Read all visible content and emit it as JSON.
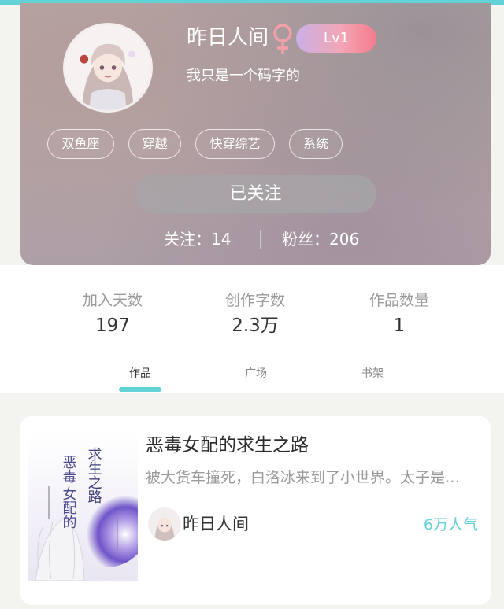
{
  "profile": {
    "username": "昨日人间",
    "gender": "female",
    "level": "Lv1",
    "bio": "我只是一个码字的",
    "tags": [
      "双鱼座",
      "穿越",
      "快穿综艺",
      "系统"
    ],
    "follow_button": "已关注",
    "following": "关注：14",
    "followers": "粉丝：206",
    "colors": {
      "accent": "#62d2d6",
      "female_icon": "#f2a0a8"
    }
  },
  "stats": [
    {
      "label": "加入天数",
      "value": "197"
    },
    {
      "label": "创作字数",
      "value": "2.3万"
    },
    {
      "label": "作品数量",
      "value": "1"
    }
  ],
  "tabs": [
    {
      "label": "作品",
      "active": true
    },
    {
      "label": "广场",
      "active": false
    },
    {
      "label": "书架",
      "active": false
    }
  ],
  "book": {
    "title": "恶毒女配的求生之路",
    "description": "被大货车撞死，白洛冰来到了小世界。太子是…",
    "author": "昨日人间",
    "popularity": "6万人气"
  }
}
